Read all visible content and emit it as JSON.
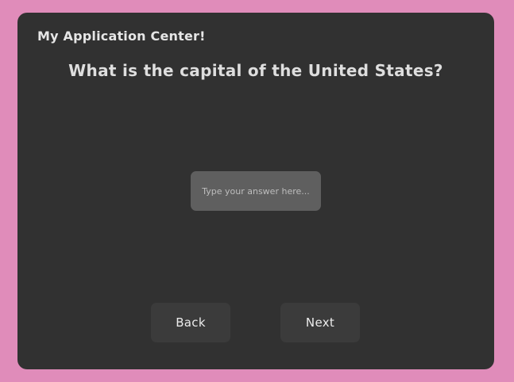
{
  "app": {
    "title": "My Application Center!"
  },
  "question": {
    "text": "What is the capital of the United States?"
  },
  "answer": {
    "value": "",
    "placeholder": "Type your answer here..."
  },
  "nav": {
    "back_label": "Back",
    "next_label": "Next"
  },
  "colors": {
    "background": "#e08cba",
    "panel": "#313131",
    "input": "#5f5f5f",
    "button": "#3b3b3b"
  }
}
